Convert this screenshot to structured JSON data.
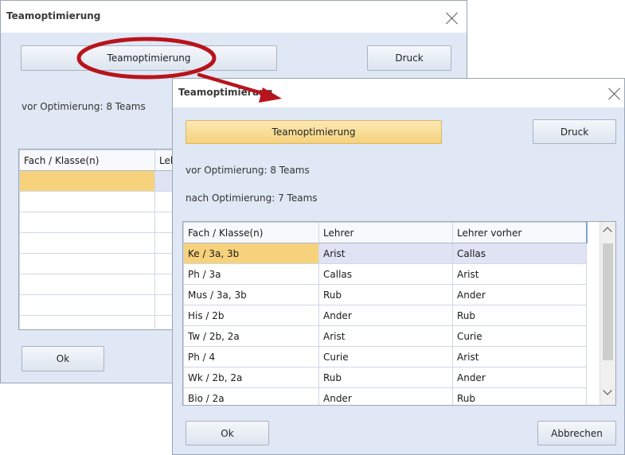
{
  "back_dialog": {
    "title": "Teamoptimierung",
    "optimize_button": "Teamoptimierung",
    "print_button": "Druck",
    "before_label": "vor Optimierung: 8 Teams",
    "columns": [
      "Fach / Klasse(n)",
      "Leh"
    ],
    "ok_button": "Ok"
  },
  "front_dialog": {
    "title": "Teamoptimierung",
    "optimize_button": "Teamoptimierung",
    "print_button": "Druck",
    "before_label": "vor Optimierung: 8 Teams",
    "after_label": "nach Optimierung: 7 Teams",
    "columns": [
      "Fach / Klasse(n)",
      "Lehrer",
      "Lehrer vorher"
    ],
    "rows": [
      [
        "Ke / 3a, 3b",
        "Arist",
        "Callas"
      ],
      [
        "Ph / 3a",
        "Callas",
        "Arist"
      ],
      [
        "Mus / 3a, 3b",
        "Rub",
        "Ander"
      ],
      [
        "His / 2b",
        "Ander",
        "Rub"
      ],
      [
        "Tw / 2b, 2a",
        "Arist",
        "Curie"
      ],
      [
        "Ph / 4",
        "Curie",
        "Arist"
      ],
      [
        "Wk / 2b, 2a",
        "Rub",
        "Ander"
      ],
      [
        "Bio / 2a",
        "Ander",
        "Rub"
      ]
    ],
    "ok_button": "Ok",
    "cancel_button": "Abbrechen"
  },
  "colors": {
    "highlight": "#f6d27c",
    "annotation": "#b8141c",
    "selection_row": "#dfe3f3"
  }
}
